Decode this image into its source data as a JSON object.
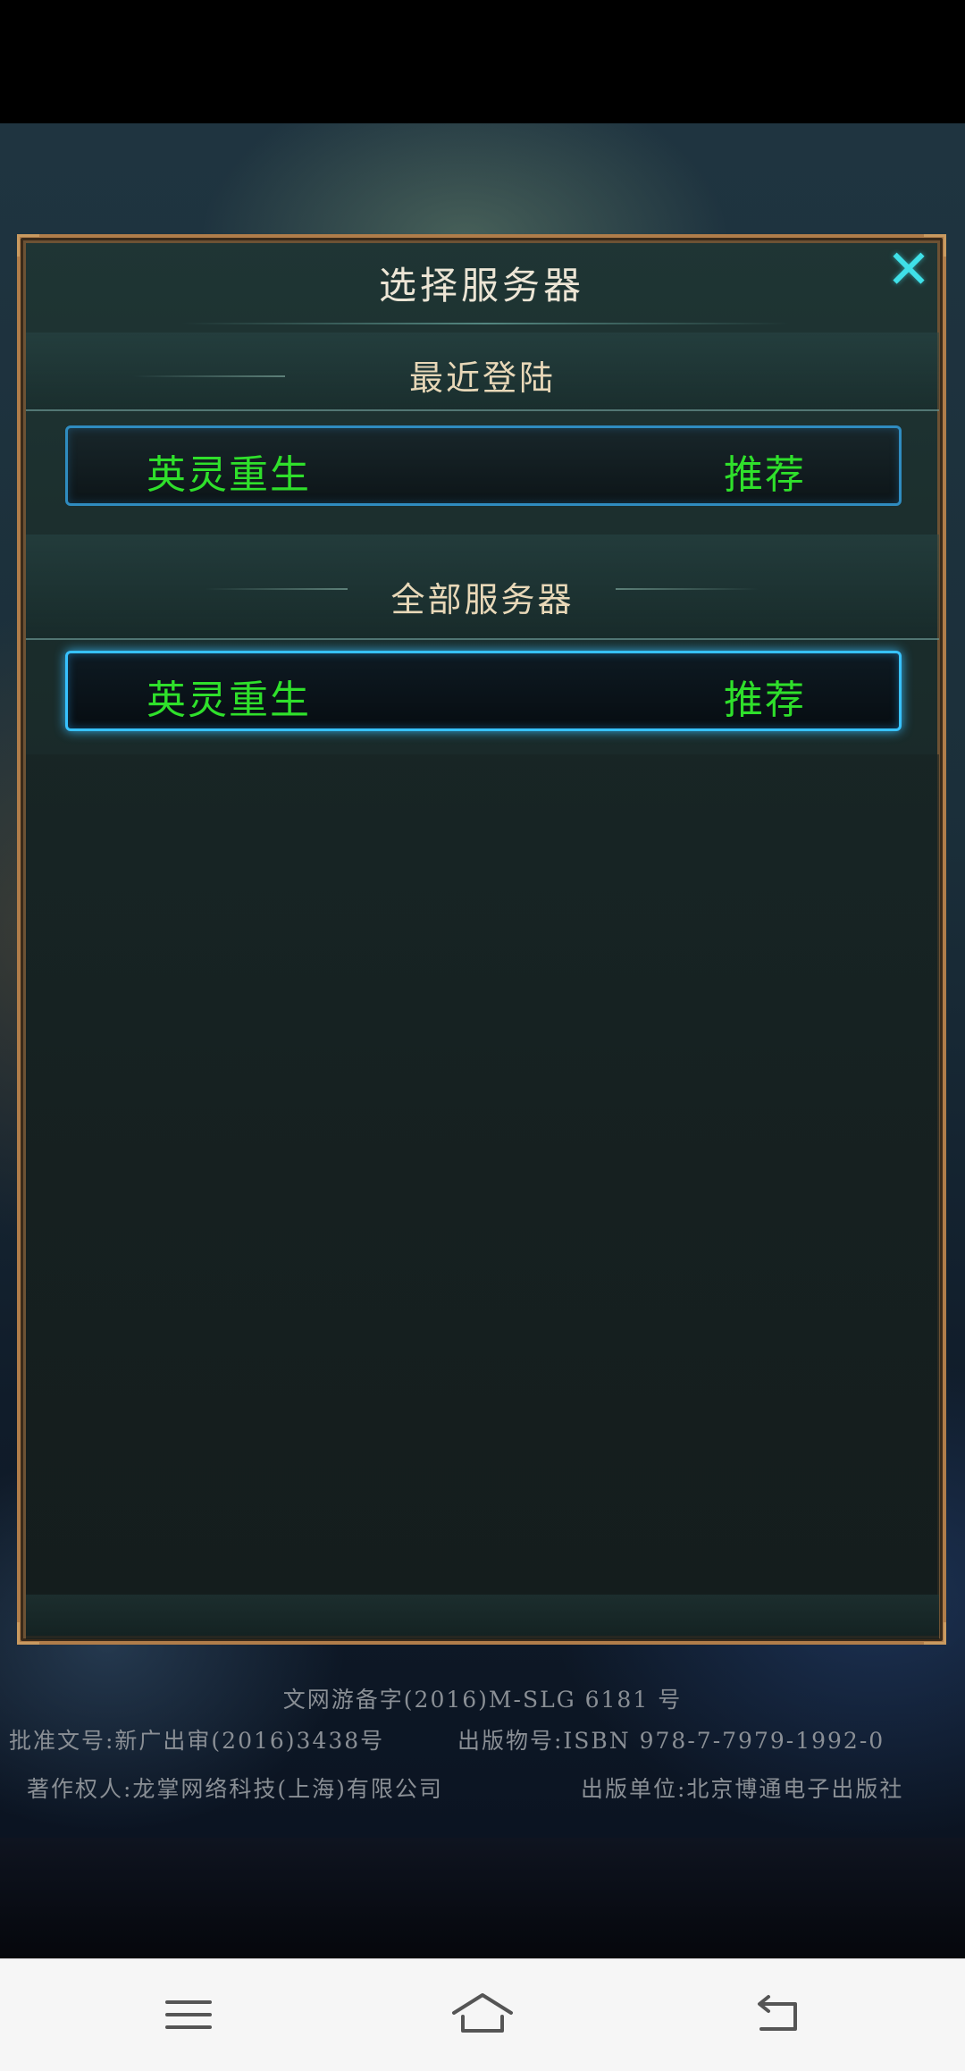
{
  "dialog": {
    "title": "选择服务器",
    "close_icon": "close-icon",
    "recent_section": {
      "title": "最近登陆",
      "servers": [
        {
          "name": "英灵重生",
          "tag": "推荐"
        }
      ]
    },
    "all_section": {
      "title": "全部服务器",
      "servers": [
        {
          "name": "英灵重生",
          "tag": "推荐",
          "selected": true
        }
      ]
    },
    "colors": {
      "server_text": "#2fe02b",
      "close": "#3fe0e8",
      "border": "#b07d4a"
    }
  },
  "legal": {
    "line1": "文网游备字(2016)M-SLG 6181 号",
    "line2_left": "批准文号:新广出审(2016)3438号",
    "line2_right": "出版物号:ISBN 978-7-7979-1992-0",
    "line3_left": "著作权人:龙掌网络科技(上海)有限公司",
    "line3_right": "出版单位:北京博通电子出版社"
  },
  "nav_bar": {
    "icons": [
      "menu-icon",
      "home-icon",
      "back-icon"
    ]
  }
}
